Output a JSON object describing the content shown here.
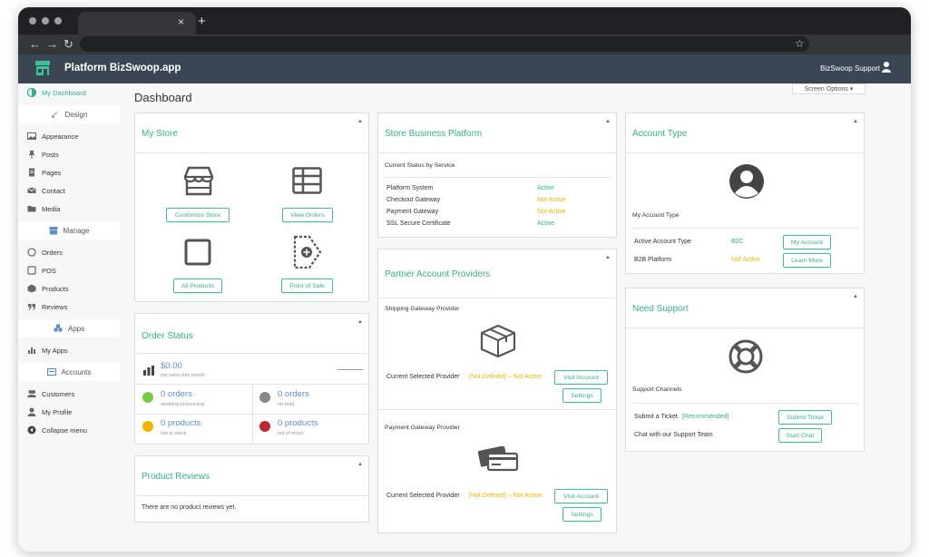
{
  "browser": {
    "tab_close": "×",
    "tab_new": "+"
  },
  "header": {
    "app_title": "Platform BizSwoop.app",
    "support_label": "BizSwoop Support"
  },
  "sidebar": {
    "dashboard": "My Dashboard",
    "design_group": "Design",
    "design_items": [
      "Appearance",
      "Posts",
      "Pages",
      "Contact",
      "Media"
    ],
    "manage_group": "Manage",
    "manage_items": [
      "Orders",
      "POS",
      "Products",
      "Reviews"
    ],
    "apps_group": "Apps",
    "apps_items": [
      "My Apps"
    ],
    "accounts_group": "Accounts",
    "accounts_items": [
      "Customers",
      "My Profile",
      "Collapse menu"
    ]
  },
  "page": {
    "title": "Dashboard",
    "screen_options": "Screen Options ▾"
  },
  "my_store": {
    "title": "My Store",
    "buttons": [
      "Customize Store",
      "View Orders",
      "All Products",
      "Point of Sale"
    ]
  },
  "order_status": {
    "title": "Order Status",
    "net_sales": "$0.00",
    "net_sales_sub": "net sales this month",
    "awaiting": "0 orders",
    "awaiting_sub": "awaiting processing",
    "onhold": "0 orders",
    "onhold_sub": "on-hold",
    "lowstock": "0 products",
    "lowstock_sub": "low in stock",
    "outstock": "0 products",
    "outstock_sub": "out of stock"
  },
  "product_reviews": {
    "title": "Product Reviews",
    "empty": "There are no product reviews yet."
  },
  "business_platform": {
    "title": "Store Business Platform",
    "subtitle": "Current Status by Service",
    "rows": [
      {
        "service": "Platform System",
        "status": "Active"
      },
      {
        "service": "Checkout Gateway",
        "status": "Not Active"
      },
      {
        "service": "Payment Gateway",
        "status": "Not Active"
      },
      {
        "service": "SSL Secure Certificate",
        "status": "Active"
      }
    ]
  },
  "partner_providers": {
    "title": "Partner Account Providers",
    "shipping_label": "Shipping Gateway Provider",
    "payment_label": "Payment Gateway Provider",
    "current_label": "Current Selected Provider",
    "not_defined": "[Not Defined] – Not Active",
    "visit_button": "Visit Account",
    "settings_button": "Settings"
  },
  "account_type": {
    "title": "Account Type",
    "label": "My Account Type",
    "active_type_label": "Active Account Type",
    "active_type_value": "B2C",
    "my_account_button": "My Account",
    "b2b_label": "B2B Platform",
    "b2b_value": "Not Active",
    "learn_more_button": "Learn More"
  },
  "need_support": {
    "title": "Need Support",
    "channels_label": "Support Channels",
    "ticket_label": "Submit a Ticket",
    "ticket_note": "[Recommended]",
    "chat_label": "Chat with our Support Team",
    "submit_button": "Submit Ticket",
    "chat_button": "Start Chat"
  },
  "colors": {
    "accent": "#33b08d",
    "warning": "#f3b400",
    "header": "#3a4654",
    "link": "#5a8fc7"
  }
}
